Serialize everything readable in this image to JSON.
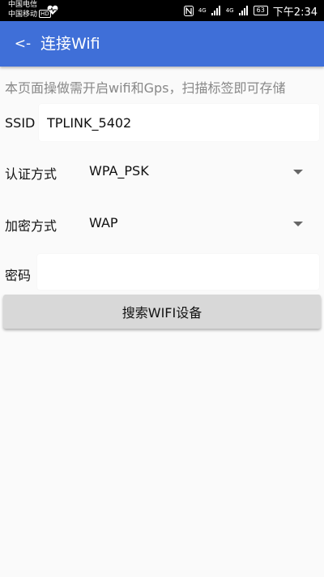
{
  "status_bar": {
    "carrier_1": "中国电信",
    "carrier_2": "中国移动",
    "hd_badge": "HD",
    "network_1": "4G",
    "network_2": "4G",
    "battery": "63",
    "time": "下午2:34",
    "icons": [
      "heart-pulse-icon",
      "nfc-icon",
      "signal-icon",
      "battery-icon"
    ]
  },
  "app_bar": {
    "back_label": "<-",
    "title": "连接Wifi",
    "color": "#3f6fd8"
  },
  "form": {
    "hint": "本页面操做需开启wifi和Gps，扫描标签即可存储",
    "ssid_label": "SSID",
    "ssid_value": "TPLINK_5402",
    "auth_label": "认证方式",
    "auth_value": "WPA_PSK",
    "encrypt_label": "加密方式",
    "encrypt_value": "WAP",
    "password_label": "密码",
    "password_value": ""
  },
  "search_button": {
    "label": "搜索WIFI设备"
  }
}
